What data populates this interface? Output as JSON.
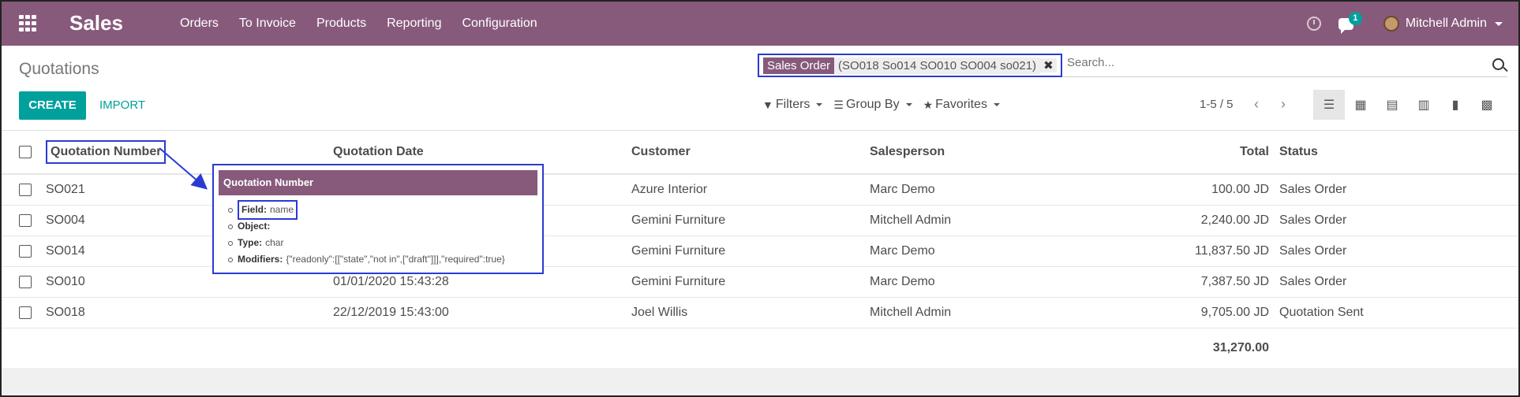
{
  "navbar": {
    "brand": "Sales",
    "menu": [
      "Orders",
      "To Invoice",
      "Products",
      "Reporting",
      "Configuration"
    ],
    "chat_badge": "1",
    "user": "Mitchell Admin",
    "color": "#875a7b"
  },
  "control": {
    "title": "Quotations",
    "create_label": "CREATE",
    "import_label": "IMPORT",
    "search": {
      "facet_label": "Sales Order",
      "facet_values": "(SO018 So014 SO010 SO004 so021)",
      "placeholder": "Search..."
    },
    "filters_label": "Filters",
    "groupby_label": "Group By",
    "favorites_label": "Favorites",
    "pager": "1-5 / 5",
    "accent": "#00a09d"
  },
  "table": {
    "headers": {
      "number": "Quotation Number",
      "date": "Quotation Date",
      "customer": "Customer",
      "salesperson": "Salesperson",
      "total": "Total",
      "status": "Status"
    },
    "rows": [
      {
        "number": "SO021",
        "date": "",
        "customer": "Azure Interior",
        "salesperson": "Marc Demo",
        "total": "100.00 JD",
        "status": "Sales Order"
      },
      {
        "number": "SO004",
        "date": "",
        "customer": "Gemini Furniture",
        "salesperson": "Mitchell Admin",
        "total": "2,240.00 JD",
        "status": "Sales Order"
      },
      {
        "number": "SO014",
        "date": "",
        "customer": "Gemini Furniture",
        "salesperson": "Marc Demo",
        "total": "11,837.50 JD",
        "status": "Sales Order"
      },
      {
        "number": "SO010",
        "date": "01/01/2020 15:43:28",
        "customer": "Gemini Furniture",
        "salesperson": "Marc Demo",
        "total": "7,387.50 JD",
        "status": "Sales Order"
      },
      {
        "number": "SO018",
        "date": "22/12/2019 15:43:00",
        "customer": "Joel Willis",
        "salesperson": "Mitchell Admin",
        "total": "9,705.00 JD",
        "status": "Quotation Sent"
      }
    ],
    "sum_total": "31,270.00"
  },
  "tooltip": {
    "title": "Quotation Number",
    "field_label": "Field:",
    "field_value": "name",
    "object_label": "Object:",
    "type_label": "Type:",
    "type_value": "char",
    "modifiers_label": "Modifiers:",
    "modifiers_value": "{\"readonly\":[[\"state\",\"not in\",[\"draft\"]]],\"required\":true}"
  }
}
